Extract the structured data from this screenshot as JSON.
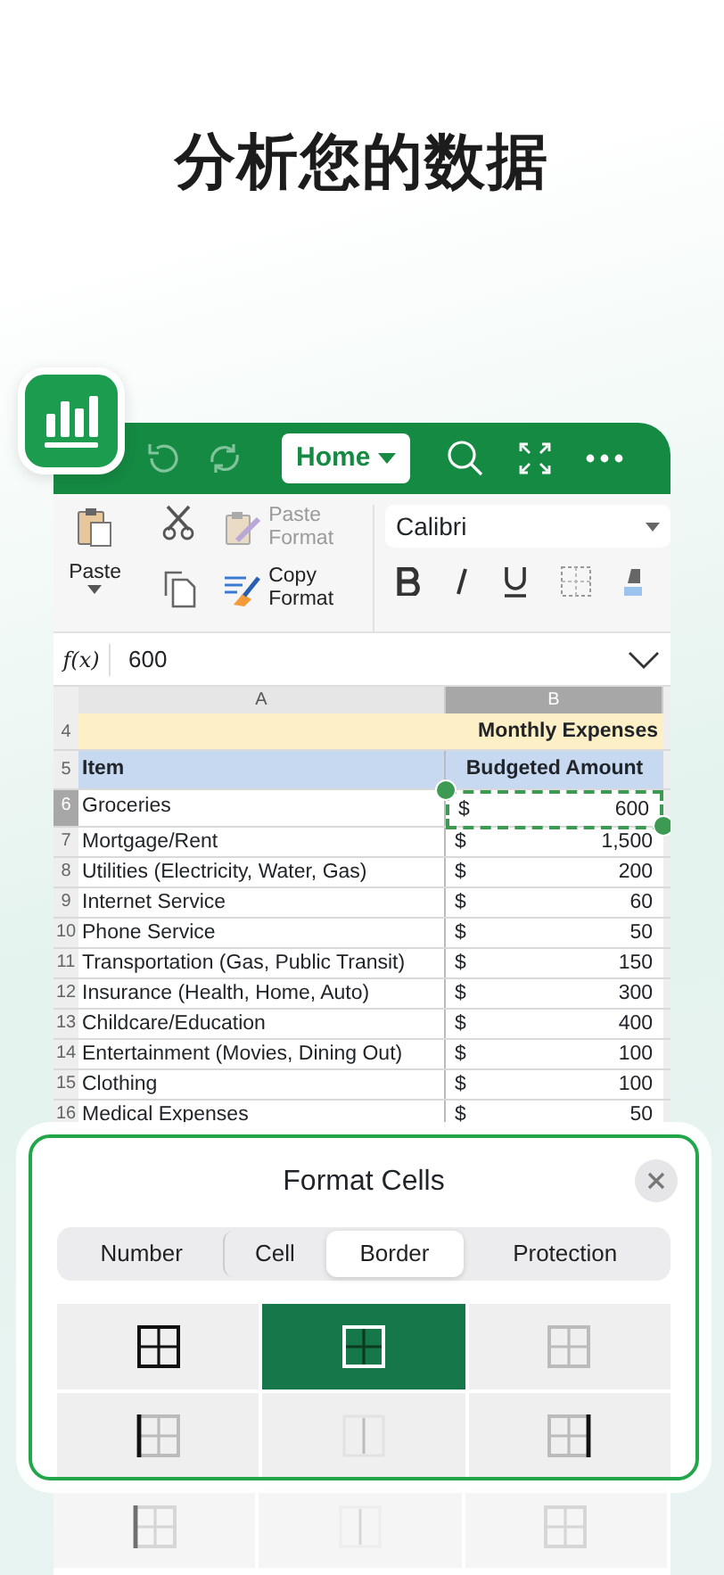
{
  "headline": "分析您的数据",
  "toolbar": {
    "menu": "Home"
  },
  "ribbon": {
    "paste": "Paste",
    "paste_format": {
      "label": "Paste Format",
      "disabled": true
    },
    "copy_format": {
      "label": "Copy Format",
      "disabled": false
    },
    "font": "Calibri"
  },
  "formula_bar": {
    "label": "f(x)",
    "value": "600"
  },
  "columns": [
    {
      "label": "A",
      "selected": false
    },
    {
      "label": "B",
      "selected": true
    }
  ],
  "rows": [
    {
      "number": "4",
      "kind": "title",
      "text": "Monthly Expenses"
    },
    {
      "number": "5",
      "kind": "header",
      "cells": [
        "Item",
        "Budgeted Amount"
      ]
    },
    {
      "number": "6",
      "kind": "data",
      "item": "Groceries",
      "currency": "$",
      "amount": "600",
      "selected": true
    },
    {
      "number": "7",
      "kind": "data",
      "item": "Mortgage/Rent",
      "currency": "$",
      "amount": "1,500",
      "selected": false
    },
    {
      "number": "8",
      "kind": "data",
      "item": "Utilities (Electricity, Water, Gas)",
      "currency": "$",
      "amount": "200",
      "selected": false
    },
    {
      "number": "9",
      "kind": "data",
      "item": "Internet Service",
      "currency": "$",
      "amount": "60",
      "selected": false
    },
    {
      "number": "10",
      "kind": "data",
      "item": "Phone Service",
      "currency": "$",
      "amount": "50",
      "selected": false
    },
    {
      "number": "11",
      "kind": "data",
      "item": "Transportation (Gas, Public Transit)",
      "currency": "$",
      "amount": "150",
      "selected": false
    },
    {
      "number": "12",
      "kind": "data",
      "item": "Insurance (Health, Home, Auto)",
      "currency": "$",
      "amount": "300",
      "selected": false
    },
    {
      "number": "13",
      "kind": "data",
      "item": "Childcare/Education",
      "currency": "$",
      "amount": "400",
      "selected": false
    },
    {
      "number": "14",
      "kind": "data",
      "item": "Entertainment (Movies, Dining Out)",
      "currency": "$",
      "amount": "100",
      "selected": false
    },
    {
      "number": "15",
      "kind": "data",
      "item": "Clothing",
      "currency": "$",
      "amount": "100",
      "selected": false
    },
    {
      "number": "16",
      "kind": "data",
      "item": "Medical Expenses",
      "currency": "$",
      "amount": "50",
      "selected": false
    }
  ],
  "dialog": {
    "title": "Format Cells",
    "tabs": [
      {
        "label": "Number",
        "selected": false
      },
      {
        "label": "Cell",
        "selected": false
      },
      {
        "label": "Border",
        "selected": true
      },
      {
        "label": "Protection",
        "selected": false
      }
    ],
    "border_options": [
      {
        "kind": "all",
        "selected": false
      },
      {
        "kind": "outside",
        "selected": true
      },
      {
        "kind": "none",
        "selected": false
      },
      {
        "kind": "left",
        "selected": false
      },
      {
        "kind": "inner-vertical",
        "selected": false
      },
      {
        "kind": "right",
        "selected": false
      }
    ]
  },
  "background_options": [
    {
      "kind": "left"
    },
    {
      "kind": "inner-vertical"
    },
    {
      "kind": "none"
    }
  ]
}
